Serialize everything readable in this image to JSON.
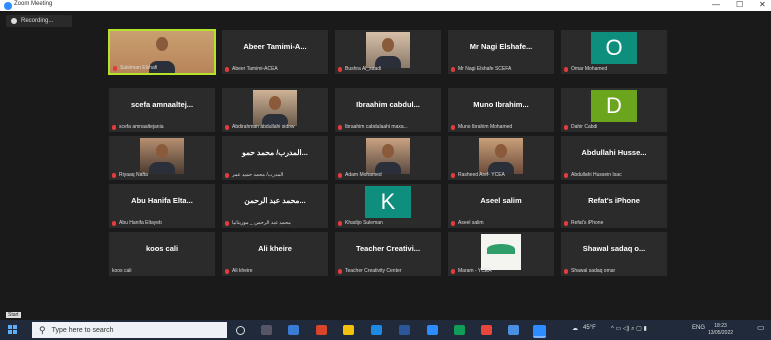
{
  "window": {
    "title": "Zoom Meeting",
    "minimize": "—",
    "maximize": "☐",
    "close": "✕"
  },
  "recording": {
    "label": "Recording..."
  },
  "tiles": [
    {
      "footer": "Suleiman Elshafi",
      "type": "video",
      "active": true
    },
    {
      "big": "Abeer Tamimi-A...",
      "footer": "Abeer Tamimi-ACEA",
      "type": "name"
    },
    {
      "footer": "Bushra Al_saadi",
      "type": "video"
    },
    {
      "big": "Mr Nagi Elshafe...",
      "footer": "Mr Nagi Elshafe SCEFA",
      "type": "name"
    },
    {
      "avatar": "O",
      "avatar_color": "#0e8f7e",
      "footer": "Omar Mohamed",
      "type": "avatar"
    },
    {
      "big": "scefa amnaaltej...",
      "footer": "scefa amnaaltejania",
      "type": "name"
    },
    {
      "footer": "Abdirahman abdullahi sidow",
      "type": "video"
    },
    {
      "big": "Ibraahim cabdul...",
      "footer": "Ibraahim cabdulaahi maxa...",
      "type": "name"
    },
    {
      "big": "Muno Ibrahim...",
      "footer": "Muno Ibrahim Mohamed",
      "type": "name"
    },
    {
      "avatar": "D",
      "avatar_color": "#6aa51d",
      "footer": "Dahir Cabdi",
      "type": "avatar"
    },
    {
      "footer": "Riyaaq Nafta",
      "type": "video"
    },
    {
      "big": "المدرب/ محمد حمو...",
      "footer": "المدرب/ محمد حميد عمر",
      "type": "name"
    },
    {
      "footer": "Adam Mohamed",
      "type": "video"
    },
    {
      "footer": "Rasheed Aref- YCEA",
      "type": "video"
    },
    {
      "big": "Abdullahi Husse...",
      "footer": "Abdullahi Hussein Isac",
      "type": "name"
    },
    {
      "big": "Abu Hanifa Elta...",
      "footer": "Abu Hanifa Eltayeb",
      "type": "name"
    },
    {
      "big": "محمد عبد الرحمن...",
      "footer": "محمد عبد الرحمن _ موريتانيا",
      "type": "name"
    },
    {
      "avatar": "K",
      "avatar_color": "#0e8f7e",
      "footer": "Khadijo Suleman",
      "type": "avatar"
    },
    {
      "big": "Aseel salim",
      "footer": "Aseel salim",
      "type": "name"
    },
    {
      "big": "Refat's iPhone",
      "footer": "Refat's iPhone",
      "type": "name"
    },
    {
      "big": "koos cali",
      "footer": "koos cali",
      "type": "name",
      "nomic": true
    },
    {
      "big": "Ali kheire",
      "footer": "Ali kheire",
      "type": "name"
    },
    {
      "big": "Teacher Creativi...",
      "footer": "Teacher Creativity Center",
      "type": "name"
    },
    {
      "footer": "Maram - YCEA",
      "type": "logo"
    },
    {
      "big": "Shawal sadaq o...",
      "footer": "Shawal sadaq omar",
      "type": "name"
    }
  ],
  "start_label": "Start",
  "taskbar": {
    "search_placeholder": "Type here to search",
    "temperature": "45°F",
    "language": "ENG",
    "time": "18:23",
    "date": "13/05/2022"
  }
}
